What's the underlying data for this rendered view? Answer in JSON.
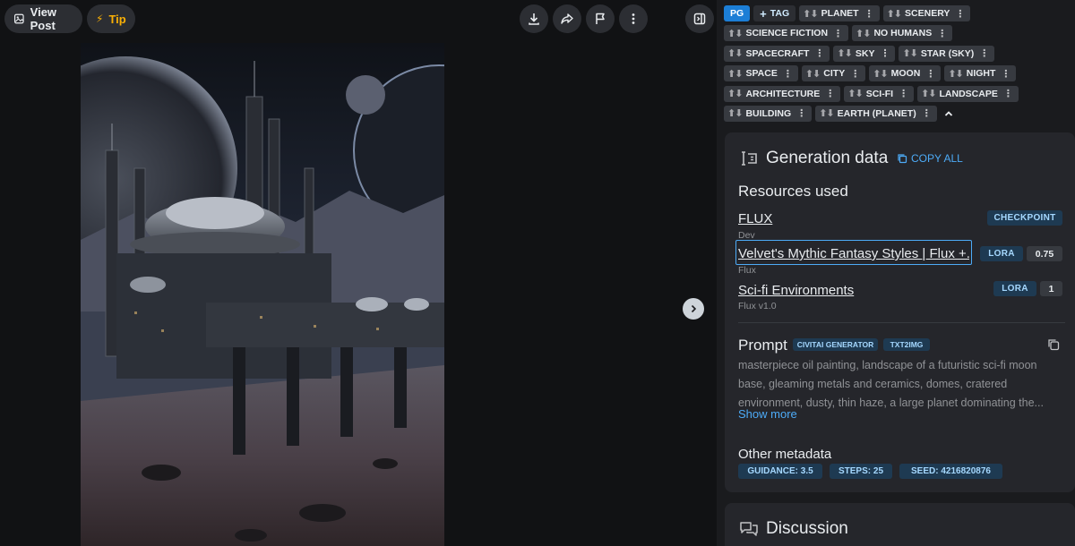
{
  "toolbar": {
    "view_post_label": "View Post",
    "tip_label": "Tip"
  },
  "tags": {
    "rating": "PG",
    "add_label": "TAG",
    "items": [
      "PLANET",
      "SCENERY",
      "SCIENCE FICTION",
      "NO HUMANS",
      "SPACECRAFT",
      "SKY",
      "STAR (SKY)",
      "SPACE",
      "CITY",
      "MOON",
      "NIGHT",
      "ARCHITECTURE",
      "SCI-FI",
      "LANDSCAPE",
      "BUILDING",
      "EARTH (PLANET)"
    ]
  },
  "generation": {
    "title": "Generation data",
    "copy_all": "COPY ALL",
    "resources_title": "Resources used",
    "resources": [
      {
        "name": "FLUX",
        "sub": "Dev",
        "type": "CHECKPOINT",
        "weight": ""
      },
      {
        "name": "Velvet's Mythic Fantasy Styles | Flux +...",
        "sub": "Flux",
        "type": "LORA",
        "weight": "0.75"
      },
      {
        "name": "Sci-fi Environments",
        "sub": "Flux v1.0",
        "type": "LORA",
        "weight": "1"
      }
    ],
    "prompt_title": "Prompt",
    "prompt_badges": [
      "CIVITAI GENERATOR",
      "TXT2IMG"
    ],
    "prompt_text": "masterpiece oil painting, landscape of a futuristic sci-fi moon base, gleaming metals and ceramics, domes, cratered environment, dusty, thin haze, a large planet dominating the...",
    "show_more": "Show more",
    "other_title": "Other metadata",
    "meta": [
      "GUIDANCE: 3.5",
      "STEPS: 25",
      "SEED: 4216820876"
    ]
  },
  "discussion": {
    "title": "Discussion"
  },
  "colors": {
    "accent": "#4dabf7",
    "badge_bg": "#1e3a52",
    "card_bg": "#25262b"
  },
  "icons": [
    "image-icon",
    "bolt-icon",
    "download-icon",
    "share-icon",
    "flag-icon",
    "more-icon",
    "panel-icon",
    "chevron-right-icon",
    "chevron-up-icon",
    "generation-icon",
    "copy-icon",
    "discussion-icon"
  ]
}
